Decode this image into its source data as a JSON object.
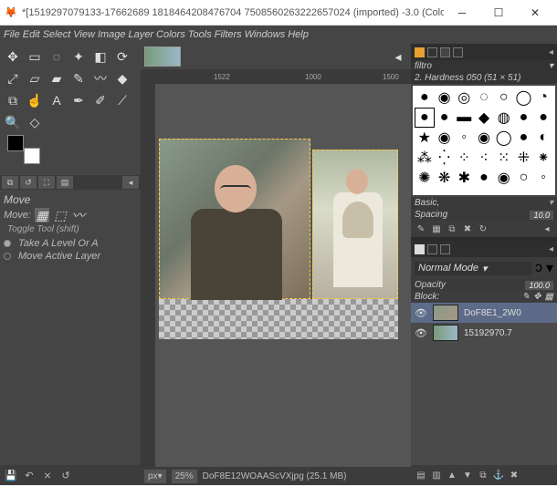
{
  "titlebar": {
    "text": "*[1519297079133-17662689 1818464208476704 7508560263222657024 (imported) -3.0 (Color..."
  },
  "menus": [
    "File",
    "Edit",
    "Select",
    "View",
    "Image",
    "Layer",
    "Colors",
    "Tools",
    "Filters",
    "Windows",
    "Help"
  ],
  "ruler": {
    "ticks": [
      {
        "pos": 80,
        "label": "1522"
      },
      {
        "pos": 180,
        "label": "1000"
      },
      {
        "pos": 265,
        "label": "1500"
      }
    ]
  },
  "tool": {
    "name": "Move",
    "mode_label": "Move:",
    "toggle_label": "Toggle Tool (shift)",
    "opt1": "Take A Level Or A",
    "opt2": "Move Active Layer"
  },
  "status": {
    "unit": "px",
    "zoom": "25%",
    "file": "DoF8E12WOAAScVXjpg (25.1 MB)"
  },
  "brushes": {
    "tab_label": "filtro",
    "current": "2. Hardness 050 (51 × 51)",
    "preset_label": "Basic,",
    "spacing_label": "Spacing",
    "spacing_val": "10.0"
  },
  "layers": {
    "blend": "Normal Mode",
    "opacity_label": "Opacity",
    "opacity_val": "100.0",
    "lock_label": "Block:",
    "items": [
      {
        "name": "DoF8E1_2W0"
      },
      {
        "name": "15192970.7"
      }
    ]
  }
}
